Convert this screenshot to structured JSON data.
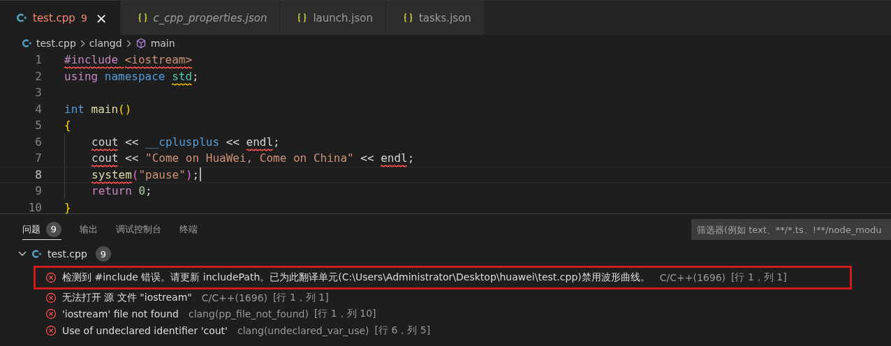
{
  "tabs": [
    {
      "label": "test.cpp",
      "kind": "cpp",
      "problems": "9",
      "close": "×",
      "italic": false,
      "selected": true
    },
    {
      "label": "c_cpp_properties.json",
      "kind": "json",
      "italic": true,
      "selected": false
    },
    {
      "label": "launch.json",
      "kind": "json",
      "italic": false,
      "selected": false
    },
    {
      "label": "tasks.json",
      "kind": "json",
      "italic": false,
      "selected": false
    }
  ],
  "breadcrumb": [
    {
      "label": "test.cpp",
      "kind": "cpp"
    },
    {
      "label": "clangd",
      "kind": "folder"
    },
    {
      "label": "main",
      "kind": "symbol"
    }
  ],
  "editor": {
    "lines": [
      {
        "number": "1",
        "current": false,
        "indented": false,
        "tokens": [
          {
            "text": "#include ",
            "kind": "keyword",
            "color": "#f14c4c"
          },
          {
            "text": "<iostream>",
            "kind": "string",
            "color": "#f14c4c"
          }
        ]
      },
      {
        "number": "2",
        "current": false,
        "indented": false,
        "tokens": [
          {
            "text": "using ",
            "kind": "keyword"
          },
          {
            "text": "namespace ",
            "kind": "storage"
          },
          {
            "text": "std",
            "kind": "namespace",
            "color": "#cca700"
          },
          {
            "text": ";",
            "kind": "plain"
          }
        ]
      },
      {
        "number": "3",
        "current": false,
        "indented": false
      },
      {
        "number": "4",
        "current": false,
        "indented": false,
        "tokens": [
          {
            "text": "int ",
            "kind": "storage"
          },
          {
            "text": "main",
            "kind": "function"
          },
          {
            "text": "()",
            "kind": "bracket"
          }
        ]
      },
      {
        "number": "5",
        "current": false,
        "indented": false,
        "tokens": [
          {
            "text": "{",
            "kind": "bracket"
          }
        ]
      },
      {
        "number": "6",
        "current": false,
        "indented": true,
        "tokens": [
          {
            "text": "cout",
            "kind": "plain",
            "color": "#f14c4c"
          },
          {
            "text": " << ",
            "kind": "plain"
          },
          {
            "text": "__cplusplus",
            "kind": "macro"
          },
          {
            "text": " << ",
            "kind": "plain"
          },
          {
            "text": "endl",
            "kind": "plain",
            "color": "#f14c4c"
          },
          {
            "text": ";",
            "kind": "plain"
          }
        ]
      },
      {
        "number": "7",
        "current": false,
        "indented": true,
        "tokens": [
          {
            "text": "cout",
            "kind": "plain",
            "color": "#f14c4c"
          },
          {
            "text": " << ",
            "kind": "plain"
          },
          {
            "text": "\"Come on HuaWei, Come on China\"",
            "kind": "string"
          },
          {
            "text": " << ",
            "kind": "plain"
          },
          {
            "text": "endl",
            "kind": "plain",
            "color": "#f14c4c"
          },
          {
            "text": ";",
            "kind": "plain"
          }
        ]
      },
      {
        "number": "8",
        "current": true,
        "indented": true,
        "tokens": [
          {
            "text": "system",
            "kind": "function",
            "color": "#f14c4c"
          },
          {
            "text": "(",
            "kind": "paren"
          },
          {
            "text": "\"pause\"",
            "kind": "string"
          },
          {
            "text": ")",
            "kind": "paren"
          },
          {
            "text": ";",
            "kind": "plain"
          }
        ]
      },
      {
        "number": "9",
        "current": false,
        "indented": true,
        "tokens": [
          {
            "text": "return ",
            "kind": "keyword"
          },
          {
            "text": "0",
            "kind": "number"
          },
          {
            "text": ";",
            "kind": "plain"
          }
        ]
      },
      {
        "number": "10",
        "current": false,
        "indented": false,
        "tokens": [
          {
            "text": "}",
            "kind": "bracket"
          }
        ]
      }
    ]
  },
  "panel": {
    "tabs": [
      {
        "label": "问题",
        "badge": "9",
        "selected": true
      },
      {
        "label": "输出",
        "selected": false
      },
      {
        "label": "调试控制台",
        "selected": false
      },
      {
        "label": "终端",
        "selected": false
      }
    ],
    "filter": {
      "placeholder": "筛选器(例如 text、**/*.ts、!**/node_modu"
    },
    "file": {
      "name": "test.cpp",
      "count": "9",
      "expanded": true
    },
    "problems": [
      {
        "message": "检测到 #include 错误。请更新 includePath。已为此翻译单元(C:\\Users\\Administrator\\Desktop\\huawei\\test.cpp)禁用波形曲线。",
        "source": "C/C++(1696)",
        "location": "[行 1，列 1]",
        "highlighted": true
      },
      {
        "message": "无法打开 源 文件 \"iostream\"",
        "source": "C/C++(1696)",
        "location": "[行 1，列 1]",
        "highlighted": false
      },
      {
        "message": "'iostream' file not found",
        "source": "clang(pp_file_not_found)",
        "location": "[行 1，列 10]",
        "highlighted": false
      },
      {
        "message": "Use of undeclared identifier 'cout'",
        "source": "clang(undeclared_var_use)",
        "location": "[行 6，列 5]",
        "highlighted": false
      }
    ]
  }
}
